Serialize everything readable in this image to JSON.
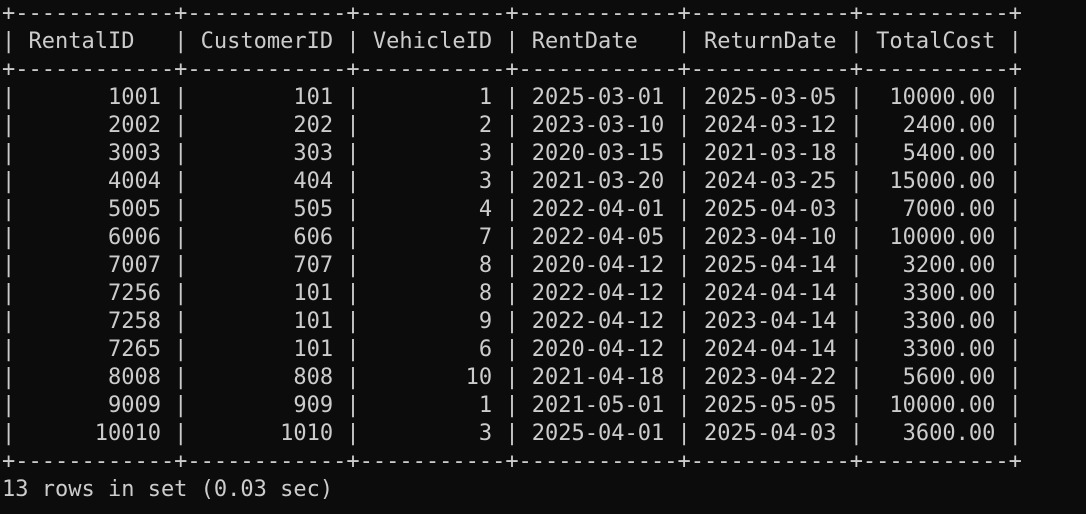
{
  "terminal": {
    "columns": [
      {
        "header": "RentalID",
        "width": 10,
        "align": "right"
      },
      {
        "header": "CustomerID",
        "width": 10,
        "align": "right"
      },
      {
        "header": "VehicleID",
        "width": 9,
        "align": "right"
      },
      {
        "header": "RentDate",
        "width": 10,
        "align": "left"
      },
      {
        "header": "ReturnDate",
        "width": 10,
        "align": "left"
      },
      {
        "header": "TotalCost",
        "width": 9,
        "align": "right"
      }
    ],
    "rows": [
      [
        "1001",
        "101",
        "1",
        "2025-03-01",
        "2025-03-05",
        "10000.00"
      ],
      [
        "2002",
        "202",
        "2",
        "2023-03-10",
        "2024-03-12",
        "2400.00"
      ],
      [
        "3003",
        "303",
        "3",
        "2020-03-15",
        "2021-03-18",
        "5400.00"
      ],
      [
        "4004",
        "404",
        "3",
        "2021-03-20",
        "2024-03-25",
        "15000.00"
      ],
      [
        "5005",
        "505",
        "4",
        "2022-04-01",
        "2025-04-03",
        "7000.00"
      ],
      [
        "6006",
        "606",
        "7",
        "2022-04-05",
        "2023-04-10",
        "10000.00"
      ],
      [
        "7007",
        "707",
        "8",
        "2020-04-12",
        "2025-04-14",
        "3200.00"
      ],
      [
        "7256",
        "101",
        "8",
        "2022-04-12",
        "2024-04-14",
        "3300.00"
      ],
      [
        "7258",
        "101",
        "9",
        "2022-04-12",
        "2023-04-14",
        "3300.00"
      ],
      [
        "7265",
        "101",
        "6",
        "2020-04-12",
        "2024-04-14",
        "3300.00"
      ],
      [
        "8008",
        "808",
        "10",
        "2021-04-18",
        "2023-04-22",
        "5600.00"
      ],
      [
        "9009",
        "909",
        "1",
        "2021-05-01",
        "2025-05-05",
        "10000.00"
      ],
      [
        "10010",
        "1010",
        "3",
        "2025-04-01",
        "2025-04-03",
        "3600.00"
      ]
    ],
    "status": "13 rows in set (0.03 sec)",
    "colors": {
      "background": "#0c0c0c",
      "text": "#cccccc"
    }
  }
}
